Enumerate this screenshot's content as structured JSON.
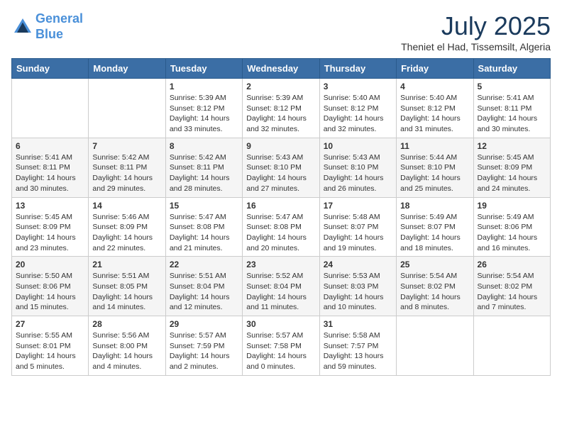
{
  "header": {
    "logo_line1": "General",
    "logo_line2": "Blue",
    "month": "July 2025",
    "location": "Theniet el Had, Tissemsilt, Algeria"
  },
  "weekdays": [
    "Sunday",
    "Monday",
    "Tuesday",
    "Wednesday",
    "Thursday",
    "Friday",
    "Saturday"
  ],
  "weeks": [
    [
      {
        "day": "",
        "info": ""
      },
      {
        "day": "",
        "info": ""
      },
      {
        "day": "1",
        "info": "Sunrise: 5:39 AM\nSunset: 8:12 PM\nDaylight: 14 hours and 33 minutes."
      },
      {
        "day": "2",
        "info": "Sunrise: 5:39 AM\nSunset: 8:12 PM\nDaylight: 14 hours and 32 minutes."
      },
      {
        "day": "3",
        "info": "Sunrise: 5:40 AM\nSunset: 8:12 PM\nDaylight: 14 hours and 32 minutes."
      },
      {
        "day": "4",
        "info": "Sunrise: 5:40 AM\nSunset: 8:12 PM\nDaylight: 14 hours and 31 minutes."
      },
      {
        "day": "5",
        "info": "Sunrise: 5:41 AM\nSunset: 8:11 PM\nDaylight: 14 hours and 30 minutes."
      }
    ],
    [
      {
        "day": "6",
        "info": "Sunrise: 5:41 AM\nSunset: 8:11 PM\nDaylight: 14 hours and 30 minutes."
      },
      {
        "day": "7",
        "info": "Sunrise: 5:42 AM\nSunset: 8:11 PM\nDaylight: 14 hours and 29 minutes."
      },
      {
        "day": "8",
        "info": "Sunrise: 5:42 AM\nSunset: 8:11 PM\nDaylight: 14 hours and 28 minutes."
      },
      {
        "day": "9",
        "info": "Sunrise: 5:43 AM\nSunset: 8:10 PM\nDaylight: 14 hours and 27 minutes."
      },
      {
        "day": "10",
        "info": "Sunrise: 5:43 AM\nSunset: 8:10 PM\nDaylight: 14 hours and 26 minutes."
      },
      {
        "day": "11",
        "info": "Sunrise: 5:44 AM\nSunset: 8:10 PM\nDaylight: 14 hours and 25 minutes."
      },
      {
        "day": "12",
        "info": "Sunrise: 5:45 AM\nSunset: 8:09 PM\nDaylight: 14 hours and 24 minutes."
      }
    ],
    [
      {
        "day": "13",
        "info": "Sunrise: 5:45 AM\nSunset: 8:09 PM\nDaylight: 14 hours and 23 minutes."
      },
      {
        "day": "14",
        "info": "Sunrise: 5:46 AM\nSunset: 8:09 PM\nDaylight: 14 hours and 22 minutes."
      },
      {
        "day": "15",
        "info": "Sunrise: 5:47 AM\nSunset: 8:08 PM\nDaylight: 14 hours and 21 minutes."
      },
      {
        "day": "16",
        "info": "Sunrise: 5:47 AM\nSunset: 8:08 PM\nDaylight: 14 hours and 20 minutes."
      },
      {
        "day": "17",
        "info": "Sunrise: 5:48 AM\nSunset: 8:07 PM\nDaylight: 14 hours and 19 minutes."
      },
      {
        "day": "18",
        "info": "Sunrise: 5:49 AM\nSunset: 8:07 PM\nDaylight: 14 hours and 18 minutes."
      },
      {
        "day": "19",
        "info": "Sunrise: 5:49 AM\nSunset: 8:06 PM\nDaylight: 14 hours and 16 minutes."
      }
    ],
    [
      {
        "day": "20",
        "info": "Sunrise: 5:50 AM\nSunset: 8:06 PM\nDaylight: 14 hours and 15 minutes."
      },
      {
        "day": "21",
        "info": "Sunrise: 5:51 AM\nSunset: 8:05 PM\nDaylight: 14 hours and 14 minutes."
      },
      {
        "day": "22",
        "info": "Sunrise: 5:51 AM\nSunset: 8:04 PM\nDaylight: 14 hours and 12 minutes."
      },
      {
        "day": "23",
        "info": "Sunrise: 5:52 AM\nSunset: 8:04 PM\nDaylight: 14 hours and 11 minutes."
      },
      {
        "day": "24",
        "info": "Sunrise: 5:53 AM\nSunset: 8:03 PM\nDaylight: 14 hours and 10 minutes."
      },
      {
        "day": "25",
        "info": "Sunrise: 5:54 AM\nSunset: 8:02 PM\nDaylight: 14 hours and 8 minutes."
      },
      {
        "day": "26",
        "info": "Sunrise: 5:54 AM\nSunset: 8:02 PM\nDaylight: 14 hours and 7 minutes."
      }
    ],
    [
      {
        "day": "27",
        "info": "Sunrise: 5:55 AM\nSunset: 8:01 PM\nDaylight: 14 hours and 5 minutes."
      },
      {
        "day": "28",
        "info": "Sunrise: 5:56 AM\nSunset: 8:00 PM\nDaylight: 14 hours and 4 minutes."
      },
      {
        "day": "29",
        "info": "Sunrise: 5:57 AM\nSunset: 7:59 PM\nDaylight: 14 hours and 2 minutes."
      },
      {
        "day": "30",
        "info": "Sunrise: 5:57 AM\nSunset: 7:58 PM\nDaylight: 14 hours and 0 minutes."
      },
      {
        "day": "31",
        "info": "Sunrise: 5:58 AM\nSunset: 7:57 PM\nDaylight: 13 hours and 59 minutes."
      },
      {
        "day": "",
        "info": ""
      },
      {
        "day": "",
        "info": ""
      }
    ]
  ]
}
